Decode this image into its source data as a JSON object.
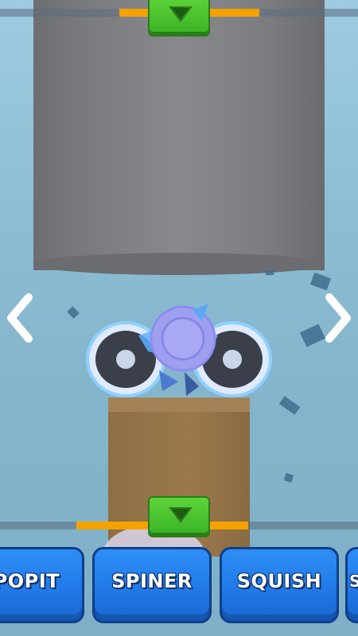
{
  "game": {
    "nav": {
      "prev": "previous-item",
      "next": "next-item"
    },
    "pointer_icon": "chevron-down-icon",
    "top_bar_progress_percent": 40,
    "bottom_bar_progress_percent": 48,
    "categories": [
      {
        "label": "POPIT"
      },
      {
        "label": "SPINER"
      },
      {
        "label": "SQUISH"
      },
      {
        "label": "SI"
      }
    ]
  },
  "colors": {
    "accent_green": "#3cb526",
    "bar_fill_orange": "#f5a100",
    "tab_blue": "#1f78e6"
  }
}
